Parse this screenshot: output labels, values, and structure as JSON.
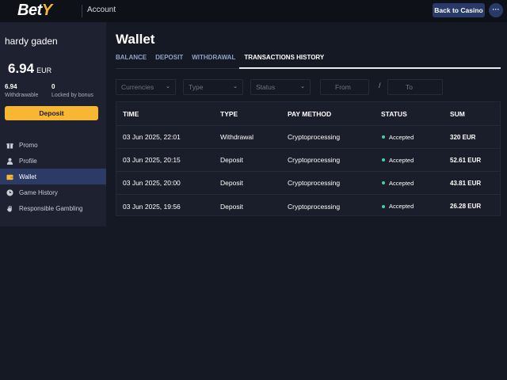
{
  "header": {
    "logo_main": "Bet",
    "logo_accent": "Y",
    "section": "Account",
    "back_label": "Back to Casino",
    "more_label": "···"
  },
  "sidebar": {
    "username": "hardy gaden",
    "balance_value": "6.94",
    "balance_currency": "EUR",
    "withdrawable_value": "6.94",
    "withdrawable_label": "Withdrawable",
    "bonus_value": "0",
    "bonus_label": "Locked by bonus",
    "deposit_label": "Deposit",
    "nav": [
      {
        "label": "Promo",
        "icon": "gift-icon"
      },
      {
        "label": "Profile",
        "icon": "user-icon"
      },
      {
        "label": "Wallet",
        "icon": "wallet-icon"
      },
      {
        "label": "Game History",
        "icon": "clock-icon"
      },
      {
        "label": "Responsible Gambling",
        "icon": "hand-icon"
      }
    ],
    "active_nav": "Wallet"
  },
  "main": {
    "title": "Wallet",
    "tabs": [
      "BALANCE",
      "DEPOSIT",
      "WITHDRAWAL",
      "TRANSACTIONS HISTORY"
    ],
    "active_tab": "TRANSACTIONS HISTORY",
    "filters": {
      "currencies_placeholder": "Currencies",
      "type_placeholder": "Type",
      "status_placeholder": "Status",
      "from_placeholder": "From",
      "separator": "/",
      "to_placeholder": "To"
    },
    "table": {
      "columns": [
        "TIME",
        "TYPE",
        "PAY METHOD",
        "STATUS",
        "SUM"
      ],
      "rows": [
        {
          "time": "03 Jun 2025, 22:01",
          "type": "Withdrawal",
          "method": "Cryptoprocessing",
          "status": "Accepted",
          "sum": "320 EUR"
        },
        {
          "time": "03 Jun 2025, 20:15",
          "type": "Deposit",
          "method": "Cryptoprocessing",
          "status": "Accepted",
          "sum": "52.61 EUR"
        },
        {
          "time": "03 Jun 2025, 20:00",
          "type": "Deposit",
          "method": "Cryptoprocessing",
          "status": "Accepted",
          "sum": "43.81 EUR"
        },
        {
          "time": "03 Jun 2025, 19:56",
          "type": "Deposit",
          "method": "Cryptoprocessing",
          "status": "Accepted",
          "sum": "26.28 EUR"
        }
      ]
    }
  },
  "colors": {
    "accent": "#f7b733",
    "nav_active": "#2c3b66",
    "status_ok": "#3fd4a4",
    "background": "#151923"
  }
}
